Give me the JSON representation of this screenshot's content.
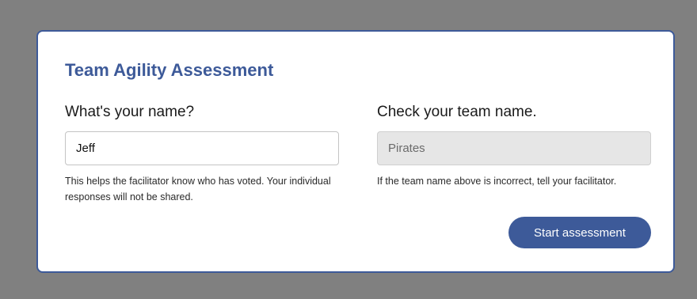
{
  "title": "Team Agility Assessment",
  "name_section": {
    "label": "What's your name?",
    "value": "Jeff",
    "help": "This helps the facilitator know who has voted. Your individual responses will not be shared."
  },
  "team_section": {
    "label": "Check your team name.",
    "value": "Pirates",
    "help": "If the team name above is incorrect, tell your facilitator."
  },
  "start_button": {
    "label": "Start assessment"
  },
  "colors": {
    "accent": "#3d5a99",
    "backdrop": "#808080",
    "card_bg": "#ffffff",
    "readonly_bg": "#e6e6e6"
  }
}
